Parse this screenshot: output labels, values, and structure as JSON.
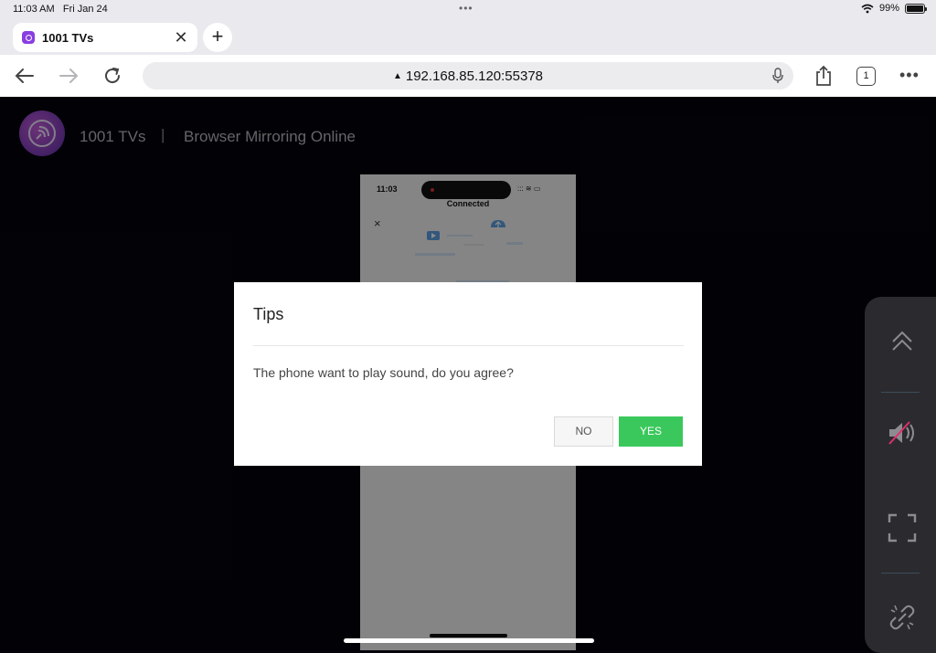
{
  "status_bar": {
    "time": "11:03 AM",
    "date": "Fri Jan 24",
    "battery": "99%",
    "battery_level": 0.99
  },
  "browser": {
    "tab": {
      "title": "1001 TVs",
      "close_icon": "close-icon"
    },
    "new_tab_icon": "plus-icon",
    "url": "192.168.85.120:55378",
    "url_warning_icon": "warning-icon",
    "mic_icon": "microphone-icon",
    "tab_count": "1"
  },
  "page": {
    "brand": "1001 TVs",
    "separator": "|",
    "subtitle": "Browser Mirroring Online"
  },
  "phone": {
    "time": "11:03",
    "status_text": "Connected",
    "close_glyph": "×"
  },
  "dialog": {
    "title": "Tips",
    "message": "The phone want to play sound, do you agree?",
    "no_label": "NO",
    "yes_label": "YES"
  },
  "side_panel": {
    "icons": [
      "chevron-up-icon",
      "speaker-muted-icon",
      "fullscreen-icon",
      "unlink-icon"
    ]
  },
  "colors": {
    "accent_green": "#3ac85c",
    "background": "#05040b",
    "panel": "#2b2b2f"
  }
}
